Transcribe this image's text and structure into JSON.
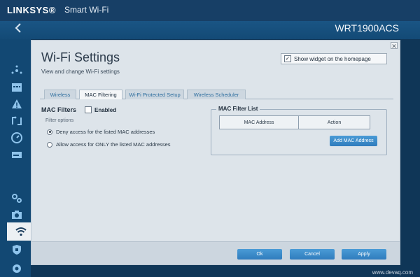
{
  "app": {
    "brand": "LINKSYS®",
    "subtitle": "Smart Wi-Fi"
  },
  "model": {
    "prefix": "WRT",
    "name": "1900ACS"
  },
  "dialog": {
    "title": "Wi-Fi Settings",
    "subtitle": "View and change Wi-Fi settings",
    "show_widget_label": "Show widget on the homepage",
    "show_widget_checked": true
  },
  "tabs": [
    {
      "label": "Wireless",
      "active": false
    },
    {
      "label": "MAC Filtering",
      "active": true
    },
    {
      "label": "Wi-Fi Protected Setup",
      "active": false
    },
    {
      "label": "Wireless Scheduler",
      "active": false
    }
  ],
  "mac_filters": {
    "title": "MAC Filters",
    "enabled_label": "Enabled",
    "enabled_checked": false,
    "filter_options_label": "Filter options",
    "options": [
      {
        "label": "Deny access for the listed MAC addresses",
        "selected": true
      },
      {
        "label": "Allow access for ONLY the listed MAC addresses",
        "selected": false
      }
    ]
  },
  "mac_list": {
    "title": "MAC Filter List",
    "col_address": "MAC Address",
    "col_action": "Action",
    "add_button": "Add MAC Address"
  },
  "footer": {
    "ok": "Ok",
    "cancel": "Cancel",
    "apply": "Apply"
  },
  "watermark": "www.devaq.com",
  "colors": {
    "header": "#173f66",
    "accent": "#2f7cbd",
    "dialog_bg": "#dde4ea"
  }
}
